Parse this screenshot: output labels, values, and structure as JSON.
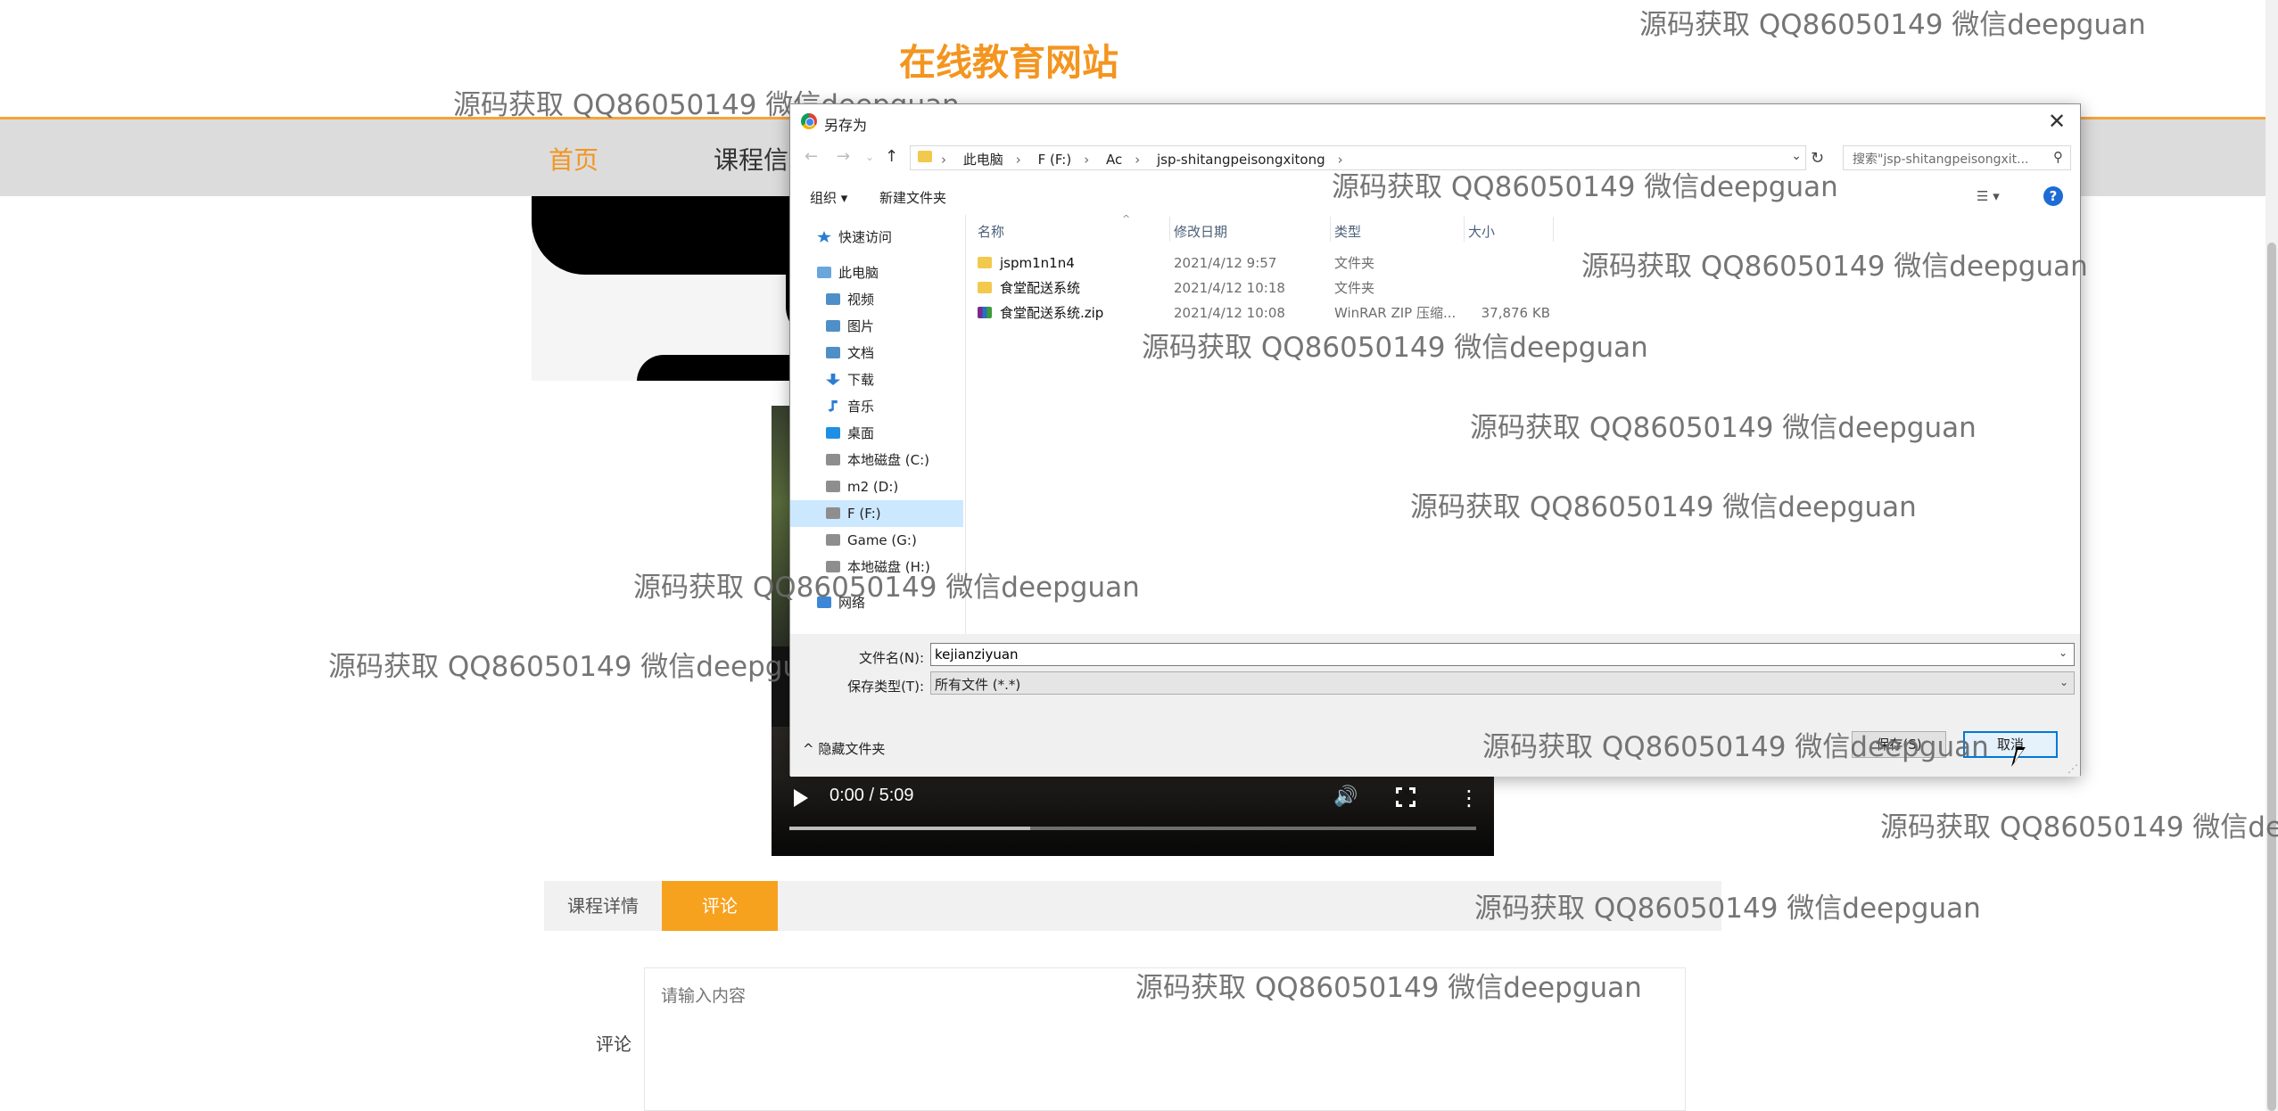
{
  "site": {
    "title": "在线教育网站",
    "nav": {
      "home": "首页",
      "course": "课程信"
    },
    "colors": {
      "accent": "#f3951f",
      "nav_bg": "#dcdcdc"
    }
  },
  "video": {
    "time": "0:00 / 5:09",
    "buffered": 0.35
  },
  "tabs": {
    "detail": "课程详情",
    "comment": "评论"
  },
  "comment": {
    "label": "评论",
    "placeholder": "请输入内容"
  },
  "dialog": {
    "title": "另存为",
    "close": "✕",
    "address": {
      "crumbs": [
        "此电脑",
        "F (F:)",
        "Ac",
        "jsp-shitangpeisongxitong"
      ]
    },
    "search_placeholder": "搜索\"jsp-shitangpeisongxit...",
    "toolbar": {
      "organize": "组织 ▾",
      "new_folder": "新建文件夹",
      "help": "?"
    },
    "nav_tree": {
      "quick_access": "快速访问",
      "this_pc": "此电脑",
      "videos": "视频",
      "pictures": "图片",
      "documents": "文档",
      "downloads": "下载",
      "music": "音乐",
      "desktop": "桌面",
      "drive_c": "本地磁盘 (C:)",
      "drive_d": "m2 (D:)",
      "drive_f": "F (F:)",
      "drive_g": "Game (G:)",
      "drive_h": "本地磁盘 (H:)",
      "network": "网络"
    },
    "columns": {
      "name": "名称",
      "date": "修改日期",
      "type": "类型",
      "size": "大小"
    },
    "files": [
      {
        "name": "jspm1n1n4",
        "date": "2021/4/12 9:57",
        "type": "文件夹",
        "size": ""
      },
      {
        "name": "食堂配送系统",
        "date": "2021/4/12 10:18",
        "type": "文件夹",
        "size": ""
      },
      {
        "name": "食堂配送系统.zip",
        "date": "2021/4/12 10:08",
        "type": "WinRAR ZIP 压缩...",
        "size": "37,876 KB"
      }
    ],
    "filename_label": "文件名(N):",
    "filename_value": "kejianziyuan",
    "filetype_label": "保存类型(T):",
    "filetype_value": "所有文件 (*.*)",
    "hide_folders": "隐藏文件夹",
    "save": "保存(S)",
    "cancel": "取消"
  },
  "watermark": "源码获取 QQ86050149 微信deepguan"
}
